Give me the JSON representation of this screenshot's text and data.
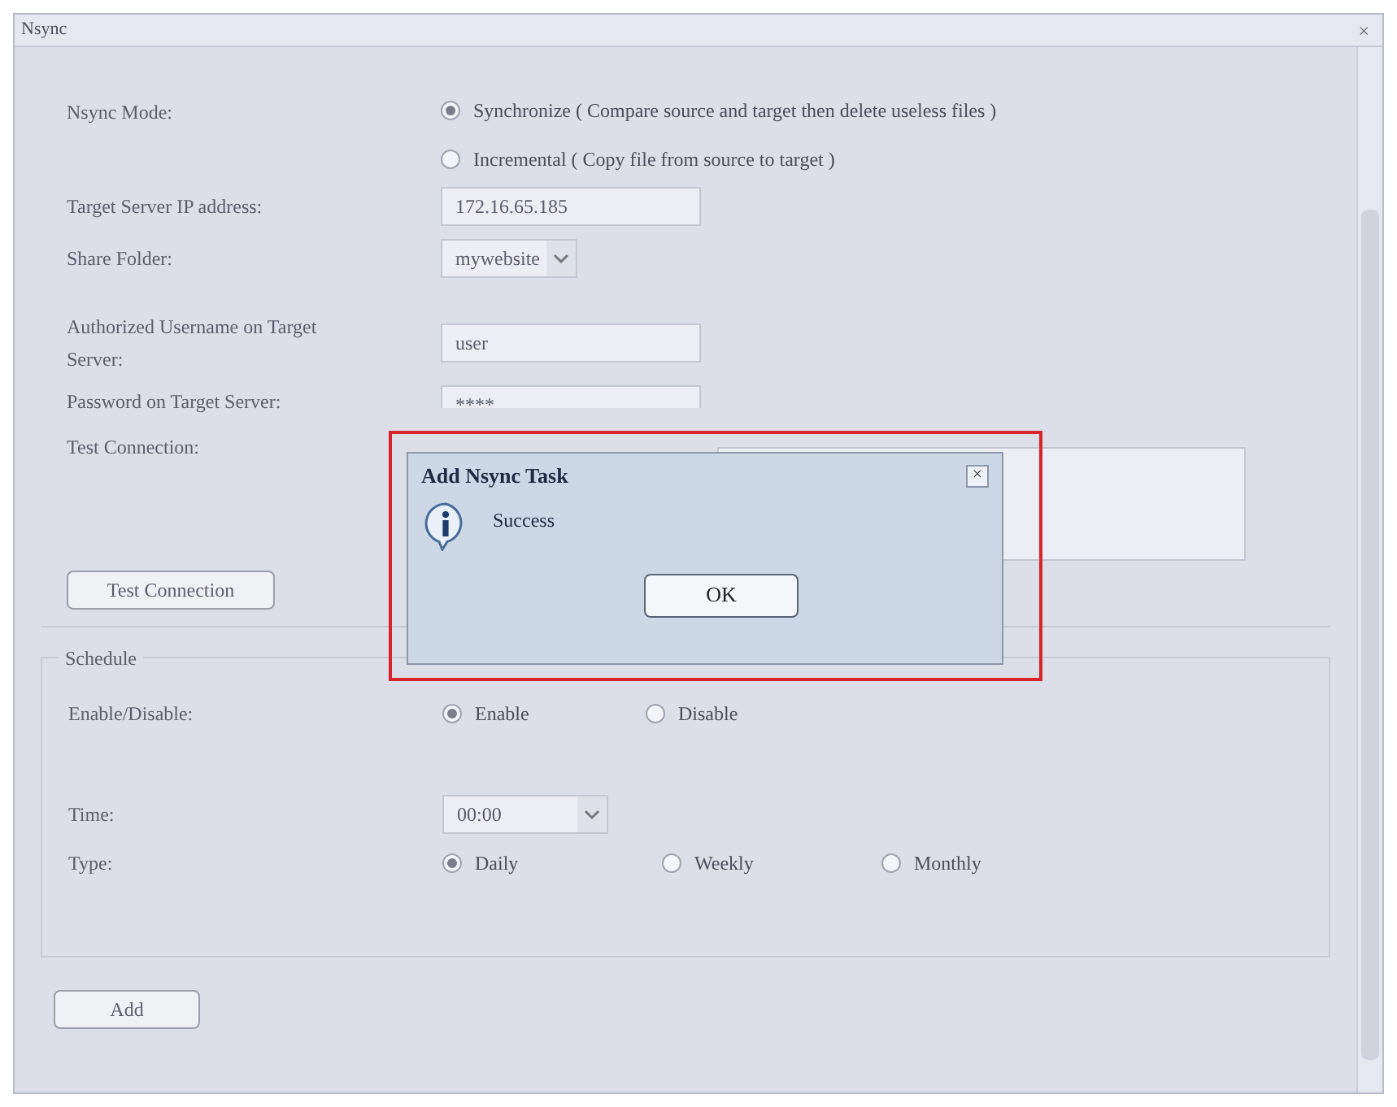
{
  "window": {
    "title": "Nsync",
    "close": "×"
  },
  "form": {
    "mode": {
      "label": "Nsync Mode:",
      "options": [
        {
          "label": "Synchronize ( Compare source and target then delete useless files )",
          "selected": true
        },
        {
          "label": "Incremental ( Copy file from source to target )",
          "selected": false
        }
      ]
    },
    "ip": {
      "label": "Target Server IP address:",
      "value": "172.16.65.185"
    },
    "share": {
      "label": "Share Folder:",
      "value": "mywebsite"
    },
    "username": {
      "label": "Authorized Username on Target Server:",
      "value": "user"
    },
    "password": {
      "label": "Password on Target Server:",
      "value": "****"
    },
    "test": {
      "label": "Test Connection:",
      "button": "Test Connection"
    }
  },
  "schedule": {
    "legend": "Schedule",
    "enable": {
      "label": "Enable/Disable:",
      "options": [
        {
          "label": "Enable",
          "selected": true
        },
        {
          "label": "Disable",
          "selected": false
        }
      ]
    },
    "time": {
      "label": "Time:",
      "value": "00:00"
    },
    "type": {
      "label": "Type:",
      "options": [
        {
          "label": "Daily",
          "selected": true
        },
        {
          "label": "Weekly",
          "selected": false
        },
        {
          "label": "Monthly",
          "selected": false
        }
      ]
    }
  },
  "add_button": "Add",
  "dialog": {
    "title": "Add Nsync Task",
    "close": "×",
    "message": "Success",
    "button": "OK"
  }
}
